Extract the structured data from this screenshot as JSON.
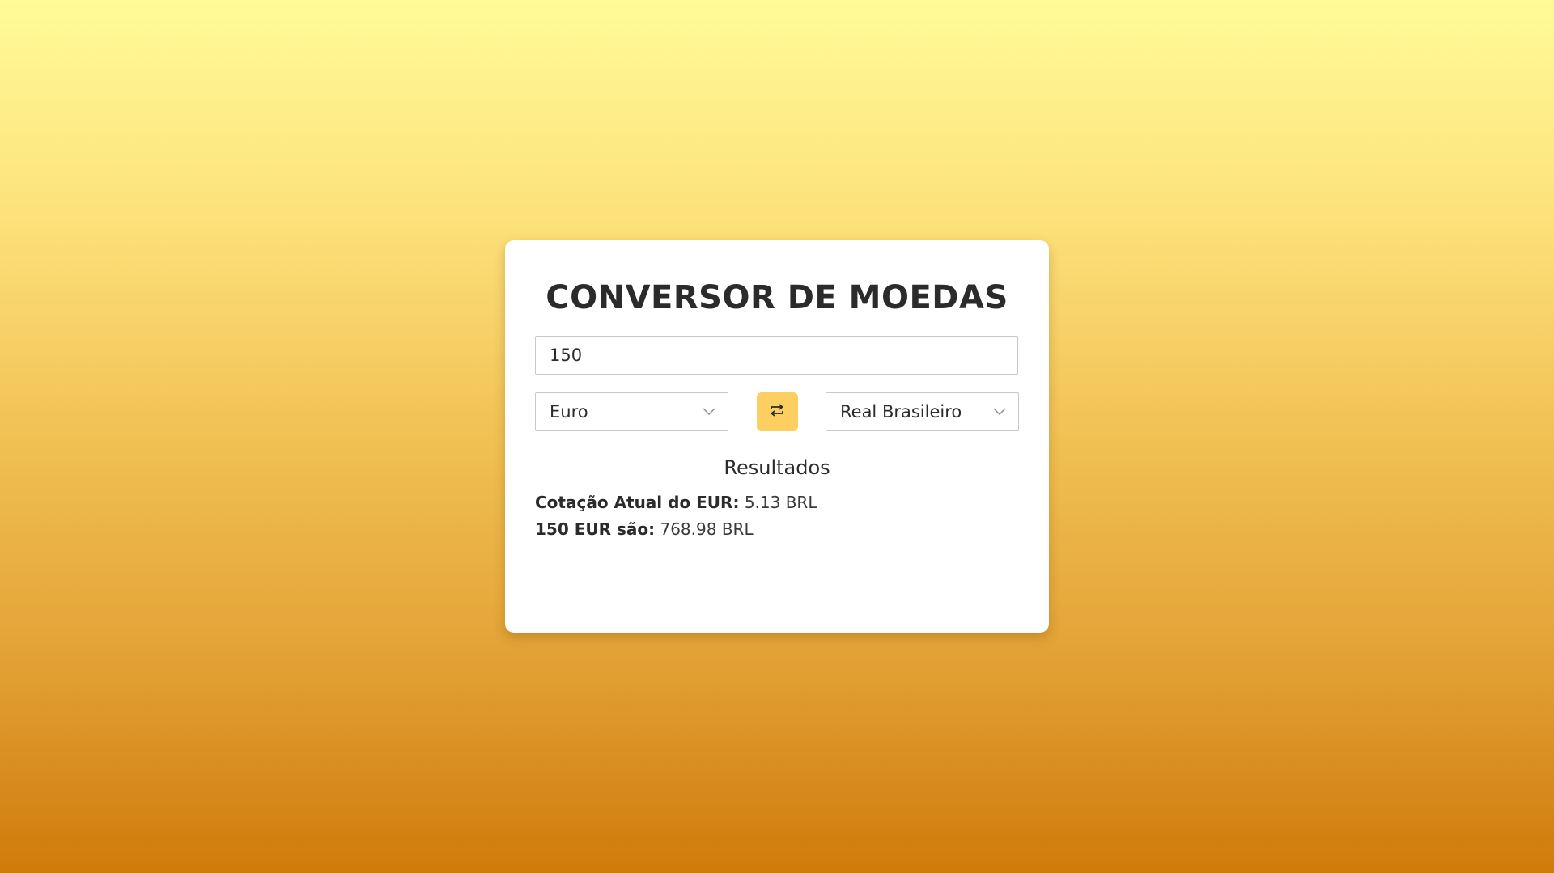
{
  "app": {
    "title": "CONVERSOR DE MOEDAS"
  },
  "converter": {
    "amount_value": "150",
    "from_currency": "Euro",
    "to_currency": "Real Brasileiro"
  },
  "results": {
    "section_label": "Resultados",
    "rate_label": "Cotação Atual do EUR:",
    "rate_value": "5.13 BRL",
    "converted_label": "150 EUR são:",
    "converted_value": "768.98 BRL"
  },
  "icons": {
    "swap": "swap-arrows-icon",
    "dropdown": "chevron-down-icon"
  },
  "colors": {
    "accent": "#fccf60",
    "text": "#2b2b2b",
    "background_top": "#fffb98",
    "background_bottom": "#cf7b0a"
  }
}
